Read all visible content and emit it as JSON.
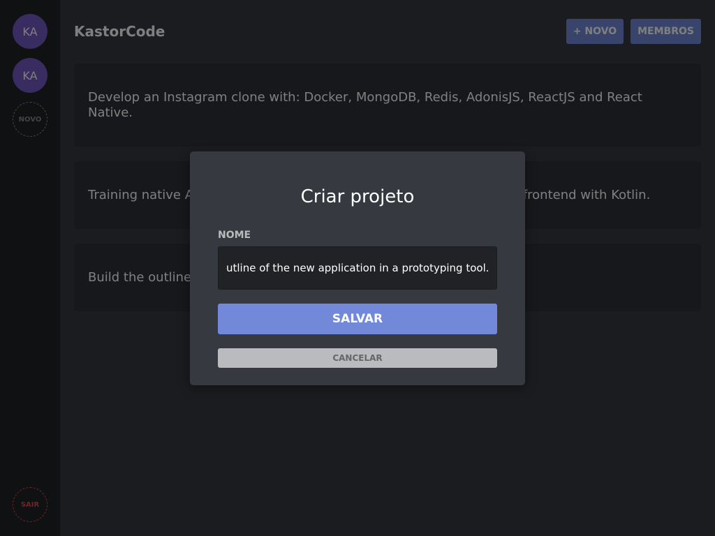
{
  "sidebar": {
    "teams": [
      {
        "initials": "KA"
      },
      {
        "initials": "KA"
      }
    ],
    "new_team_label": "NOVO",
    "signout_label": "SAIR"
  },
  "header": {
    "org_title": "KastorCode",
    "new_button_label": "+ NOVO",
    "members_button_label": "MEMBROS"
  },
  "projects": [
    {
      "title": "Develop an Instagram clone with: Docker, MongoDB, Redis, AdonisJS, ReactJS and React Native."
    },
    {
      "title": "Training native Android development using Rust on the backend and frontend with Kotlin."
    },
    {
      "title": "Build the outline of the new application in a prototyping tool."
    }
  ],
  "modal": {
    "title": "Criar projeto",
    "name_label": "NOME",
    "name_value": "Build the outline of the new application in a prototyping tool.",
    "save_label": "SALVAR",
    "cancel_label": "CANCELAR"
  },
  "colors": {
    "accent": "#7289da",
    "avatar": "#7159c1",
    "danger": "#e04848"
  }
}
